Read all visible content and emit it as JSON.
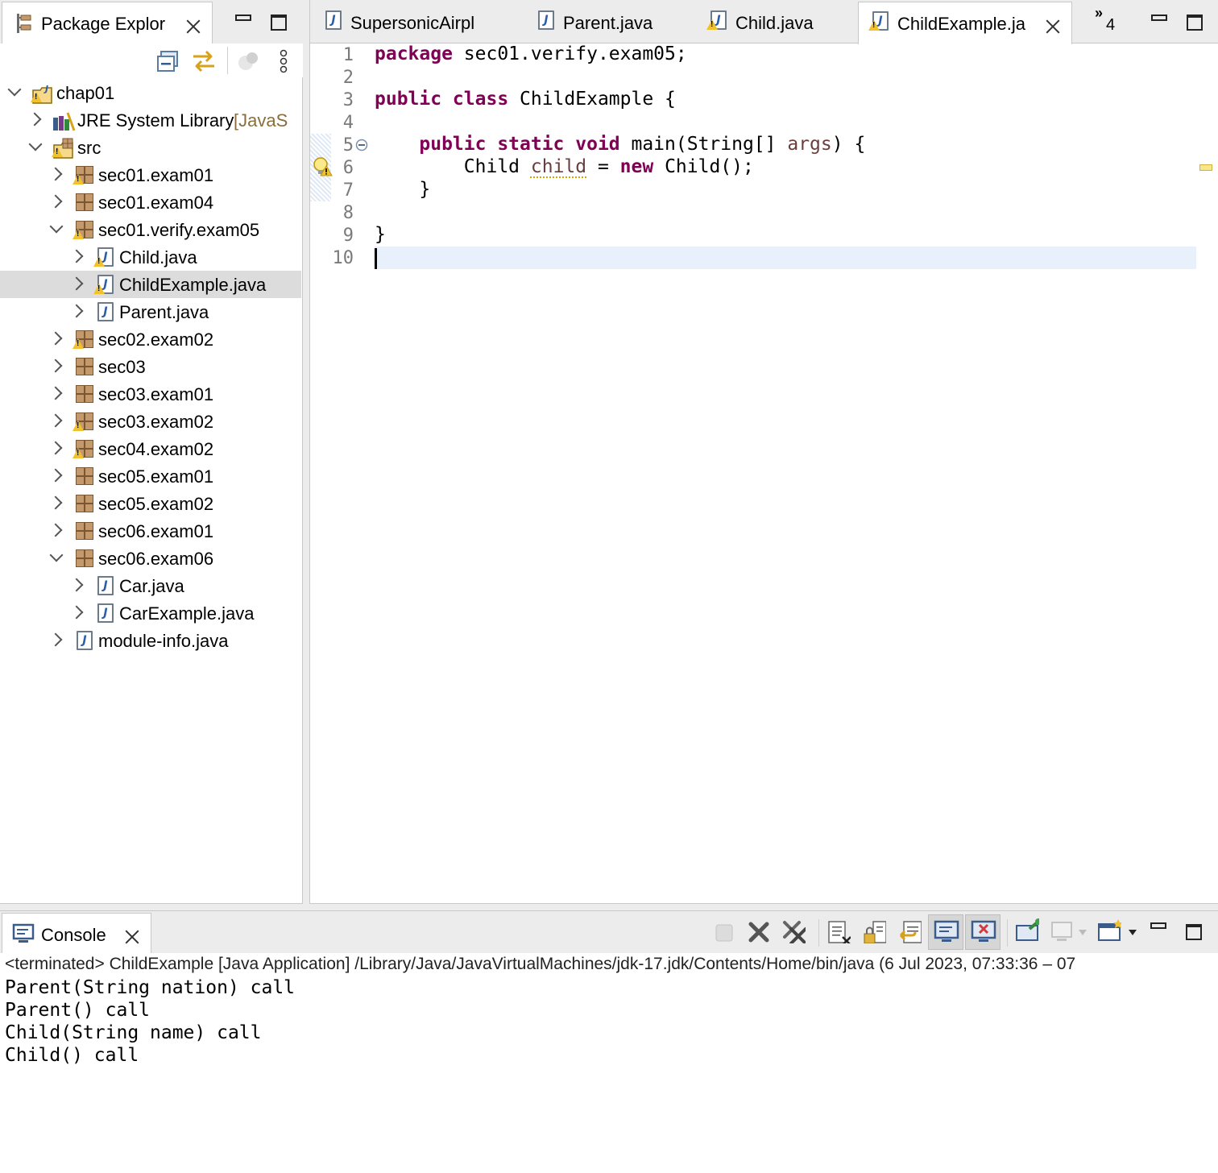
{
  "explorer": {
    "tab_label": "Package Explor",
    "tree": [
      {
        "label": "chap01",
        "sub": "",
        "indent": 0,
        "chevron": "down",
        "icon": "project-icon",
        "warn": true
      },
      {
        "label": "JRE System Library",
        "sub": " [JavaS",
        "indent": 1,
        "chevron": "right",
        "icon": "library-icon",
        "warn": false
      },
      {
        "label": "src",
        "sub": "",
        "indent": 1,
        "chevron": "down",
        "icon": "source-folder-icon",
        "warn": true
      },
      {
        "label": "sec01.exam01",
        "sub": "",
        "indent": 2,
        "chevron": "right",
        "icon": "package-icon",
        "warn": true
      },
      {
        "label": "sec01.exam04",
        "sub": "",
        "indent": 2,
        "chevron": "right",
        "icon": "package-icon",
        "warn": false
      },
      {
        "label": "sec01.verify.exam05",
        "sub": "",
        "indent": 2,
        "chevron": "down",
        "icon": "package-icon",
        "warn": true
      },
      {
        "label": "Child.java",
        "sub": "",
        "indent": 3,
        "chevron": "right",
        "icon": "java-file-icon",
        "warn": true
      },
      {
        "label": "ChildExample.java",
        "sub": "",
        "indent": 3,
        "chevron": "right",
        "icon": "java-file-icon",
        "warn": true,
        "selected": true
      },
      {
        "label": "Parent.java",
        "sub": "",
        "indent": 3,
        "chevron": "right",
        "icon": "java-file-icon",
        "warn": false
      },
      {
        "label": "sec02.exam02",
        "sub": "",
        "indent": 2,
        "chevron": "right",
        "icon": "package-icon",
        "warn": true
      },
      {
        "label": "sec03",
        "sub": "",
        "indent": 2,
        "chevron": "right",
        "icon": "package-icon",
        "warn": false
      },
      {
        "label": "sec03.exam01",
        "sub": "",
        "indent": 2,
        "chevron": "right",
        "icon": "package-icon",
        "warn": false
      },
      {
        "label": "sec03.exam02",
        "sub": "",
        "indent": 2,
        "chevron": "right",
        "icon": "package-icon",
        "warn": true
      },
      {
        "label": "sec04.exam02",
        "sub": "",
        "indent": 2,
        "chevron": "right",
        "icon": "package-icon",
        "warn": true
      },
      {
        "label": "sec05.exam01",
        "sub": "",
        "indent": 2,
        "chevron": "right",
        "icon": "package-icon",
        "warn": false
      },
      {
        "label": "sec05.exam02",
        "sub": "",
        "indent": 2,
        "chevron": "right",
        "icon": "package-icon",
        "warn": false
      },
      {
        "label": "sec06.exam01",
        "sub": "",
        "indent": 2,
        "chevron": "right",
        "icon": "package-icon",
        "warn": false
      },
      {
        "label": "sec06.exam06",
        "sub": "",
        "indent": 2,
        "chevron": "down",
        "icon": "package-icon",
        "warn": false
      },
      {
        "label": "Car.java",
        "sub": "",
        "indent": 3,
        "chevron": "right",
        "icon": "java-file-icon",
        "warn": false
      },
      {
        "label": "CarExample.java",
        "sub": "",
        "indent": 3,
        "chevron": "right",
        "icon": "java-file-icon",
        "warn": false
      },
      {
        "label": "module-info.java",
        "sub": "",
        "indent": 2,
        "chevron": "right",
        "icon": "java-file-icon",
        "warn": false
      }
    ]
  },
  "editor": {
    "tabs": [
      {
        "label": "SupersonicAirpl",
        "warn": false,
        "active": false
      },
      {
        "label": "Parent.java",
        "warn": false,
        "active": false
      },
      {
        "label": "Child.java",
        "warn": true,
        "active": false
      },
      {
        "label": "ChildExample.ja",
        "warn": true,
        "active": true
      }
    ],
    "overflow_count": "4",
    "line_numbers": [
      "1",
      "2",
      "3",
      "4",
      "5",
      "6",
      "7",
      "8",
      "9",
      "10"
    ],
    "code": {
      "l1_kw": "package",
      "l1_rest": " sec01.verify.exam05;",
      "l3_kw": "public class",
      "l3_rest": " ChildExample {",
      "l5_indent": "    ",
      "l5_kw": "public static void",
      "l5_rest": " main(String[] ",
      "l5_param": "args",
      "l5_end": ") {",
      "l6_indent": "        Child ",
      "l6_var": "child",
      "l6_mid": " = ",
      "l6_kw": "new",
      "l6_end": " Child();",
      "l7": "    }",
      "l9": "}"
    }
  },
  "console": {
    "tab_label": "Console",
    "header": "<terminated> ChildExample [Java Application] /Library/Java/JavaVirtualMachines/jdk-17.jdk/Contents/Home/bin/java  (6 Jul 2023, 07:33:36 – 07",
    "output": [
      "Parent(String nation) call",
      "Parent() call",
      "Child(String name) call",
      "Child() call"
    ]
  },
  "colors": {
    "keyword": "#7f0055",
    "current_line": "#e8f0fb",
    "selection": "#dcdcdc"
  }
}
